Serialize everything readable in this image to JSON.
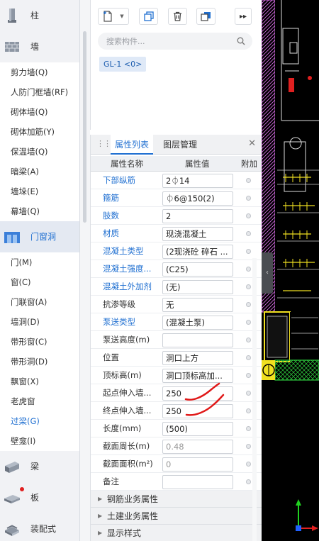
{
  "nav": {
    "categories": [
      {
        "label": "柱"
      },
      {
        "label": "墙"
      }
    ],
    "wall_items": [
      "剪力墙(Q)",
      "人防门框墙(RF)",
      "砌体墙(Q)",
      "砌体加筋(Y)",
      "保温墙(Q)",
      "暗梁(A)",
      "墙垛(E)",
      "幕墙(Q)"
    ],
    "door_category": {
      "label": "门窗洞"
    },
    "door_items": [
      "门(M)",
      "窗(C)",
      "门联窗(A)",
      "墙洞(D)",
      "带形窗(C)",
      "带形洞(D)",
      "飘窗(X)",
      "老虎窗",
      "过梁(G)",
      "壁龛(I)"
    ],
    "selected_item": "过梁(G)",
    "bottom_categories": [
      {
        "label": "梁"
      },
      {
        "label": "板"
      },
      {
        "label": "装配式"
      }
    ]
  },
  "component": {
    "search_placeholder": "搜索构件...",
    "chip": "GL-1 <0>"
  },
  "props": {
    "tabs": [
      {
        "label": "属性列表"
      },
      {
        "label": "图层管理"
      }
    ],
    "headers": {
      "name": "属性名称",
      "value": "属性值",
      "extra": "附加"
    },
    "rows": [
      {
        "name": "下部纵筋",
        "value": "2⏀14",
        "link": true
      },
      {
        "name": "箍筋",
        "value": "⏀6@150(2)",
        "link": true
      },
      {
        "name": "肢数",
        "value": "2",
        "link": true
      },
      {
        "name": "材质",
        "value": "现浇混凝土",
        "link": true
      },
      {
        "name": "混凝土类型",
        "value": "(2现浇砼 碎石 ...",
        "link": true
      },
      {
        "name": "混凝土强度...",
        "value": "(C25)",
        "link": true
      },
      {
        "name": "混凝土外加剂",
        "value": "(无)",
        "link": true
      },
      {
        "name": "抗渗等级",
        "value": "无",
        "link": false
      },
      {
        "name": "泵送类型",
        "value": "(混凝土泵)",
        "link": true
      },
      {
        "name": "泵送高度(m)",
        "value": "",
        "link": false
      },
      {
        "name": "位置",
        "value": "洞口上方",
        "link": false
      },
      {
        "name": "顶标高(m)",
        "value": "洞口顶标高加...",
        "link": false
      },
      {
        "name": "起点伸入墙...",
        "value": "250",
        "link": false
      },
      {
        "name": "终点伸入墙...",
        "value": "250",
        "link": false
      },
      {
        "name": "长度(mm)",
        "value": "(500)",
        "link": false
      },
      {
        "name": "截面周长(m)",
        "value": "0.48",
        "link": false,
        "readonly": true
      },
      {
        "name": "截面面积(m²)",
        "value": "0",
        "link": false,
        "readonly": true
      },
      {
        "name": "备注",
        "value": "",
        "link": false
      }
    ],
    "groups": [
      "钢筋业务属性",
      "土建业务属性",
      "显示样式"
    ]
  },
  "colors": {
    "accent": "#1f6fd1",
    "annotation_red": "#e01818",
    "cad_magenta": "#d070e0",
    "cad_green": "#20c020",
    "cad_yellow": "#f0e020"
  }
}
